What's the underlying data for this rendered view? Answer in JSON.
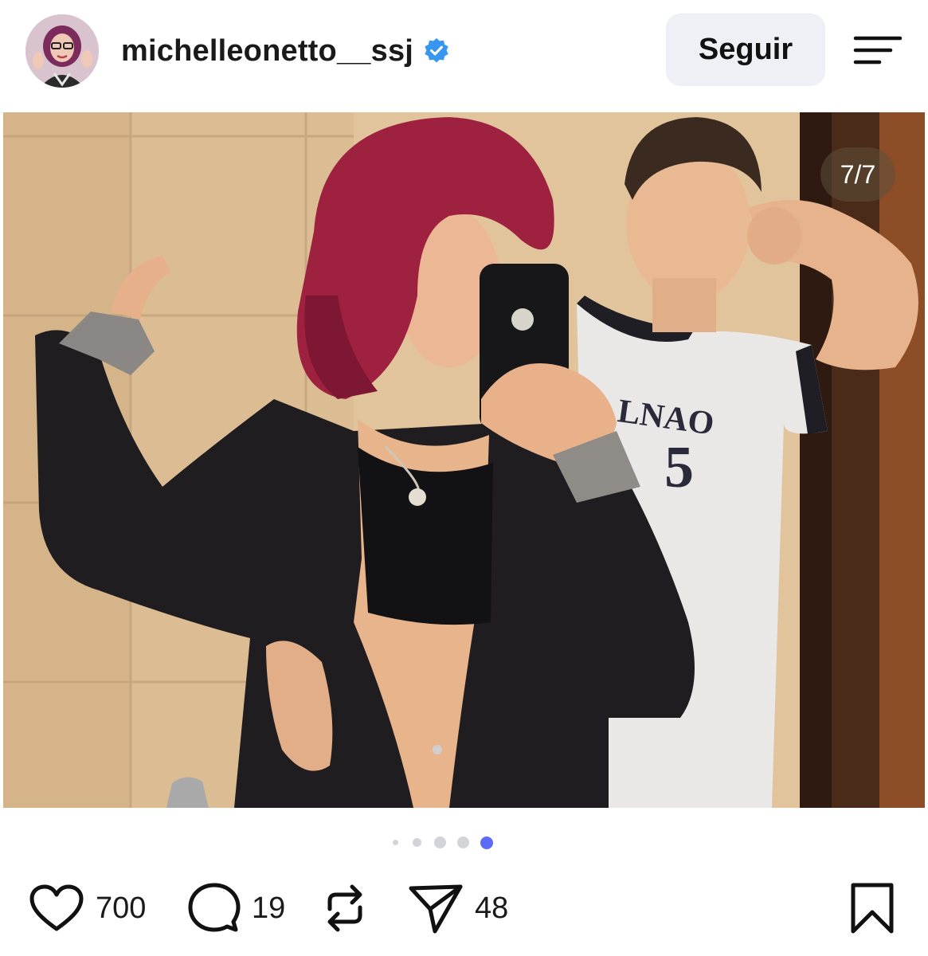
{
  "post": {
    "username": "michelleonetto__ssj",
    "verified_icon": "verified-badge-icon",
    "follow_label": "Seguir",
    "menu_icon": "menu-icon",
    "media_counter": "7/7",
    "carousel": {
      "total_pages": 5,
      "active_index": 4
    }
  },
  "actions": {
    "likes": "700",
    "comments": "19",
    "shares": "48",
    "icons": [
      "heart-icon",
      "comment-icon",
      "repost-icon",
      "share-icon",
      "bookmark-icon"
    ]
  },
  "colors": {
    "verified_blue": "#3797f0",
    "active_dot": "#5b6bf5",
    "inactive_dot": "#d2d4da",
    "follow_button_bg": "#eef0f5"
  }
}
